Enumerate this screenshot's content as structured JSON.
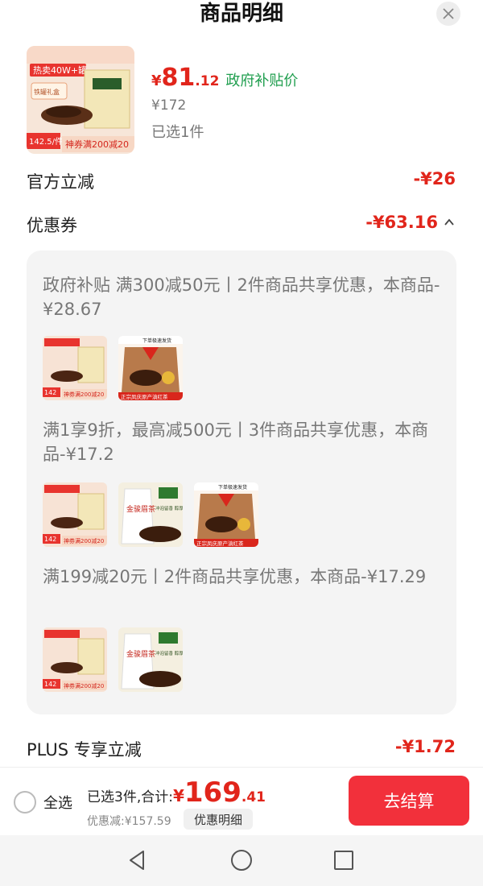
{
  "header": {
    "title": "商品明细"
  },
  "product": {
    "currency": "¥",
    "price_int": "81",
    "price_dec": ".12",
    "subsidy_tag": "政府补贴价",
    "original_price": "¥172",
    "selected": "已选1件",
    "image_text": {
      "top_banner": "热卖40W+罐",
      "tag_small": "铁罐礼盒",
      "price_tag": "142.5/件",
      "bottom": "神券满200减20"
    }
  },
  "discounts": {
    "official": {
      "label": "官方立减",
      "value": "-¥26"
    },
    "coupon": {
      "label": "优惠券",
      "value": "-¥63.16"
    },
    "plus": {
      "label": "PLUS 专享立减",
      "value": "-¥1.72"
    }
  },
  "coupons": [
    {
      "text": "政府补贴 满300减50元丨2件商品共享优惠，本商品-¥28.67",
      "thumbs": [
        "tin",
        "bag"
      ]
    },
    {
      "text": "满1享9折，最高减500元丨3件商品共享优惠，本商品-¥17.2",
      "thumbs": [
        "tin",
        "white",
        "bag"
      ]
    },
    {
      "text": "满199减20元丨2件商品共享优惠，本商品-¥17.29",
      "thumbs": [
        "tin",
        "white"
      ]
    }
  ],
  "thumb_text": {
    "tin_bottom": "神券满200减20",
    "tin_price": "142",
    "bag_banner": "正宗凤庆原产滇红茶",
    "bag_top": "下单极速发货",
    "white_label": "金骏眉茶",
    "white_side": "冲泡留香 醇厚回甘"
  },
  "bottom_bar": {
    "select_all": "全选",
    "total_label": "已选3件,合计:",
    "currency": "¥",
    "total_int": "169",
    "total_dec": ".41",
    "saved": "优惠减:¥157.59",
    "detail_button": "优惠明细",
    "checkout_button": "去结算"
  },
  "colors": {
    "price_red": "#e1251b",
    "subsidy_green": "#1f9e4e",
    "checkout": "#f2303b"
  }
}
